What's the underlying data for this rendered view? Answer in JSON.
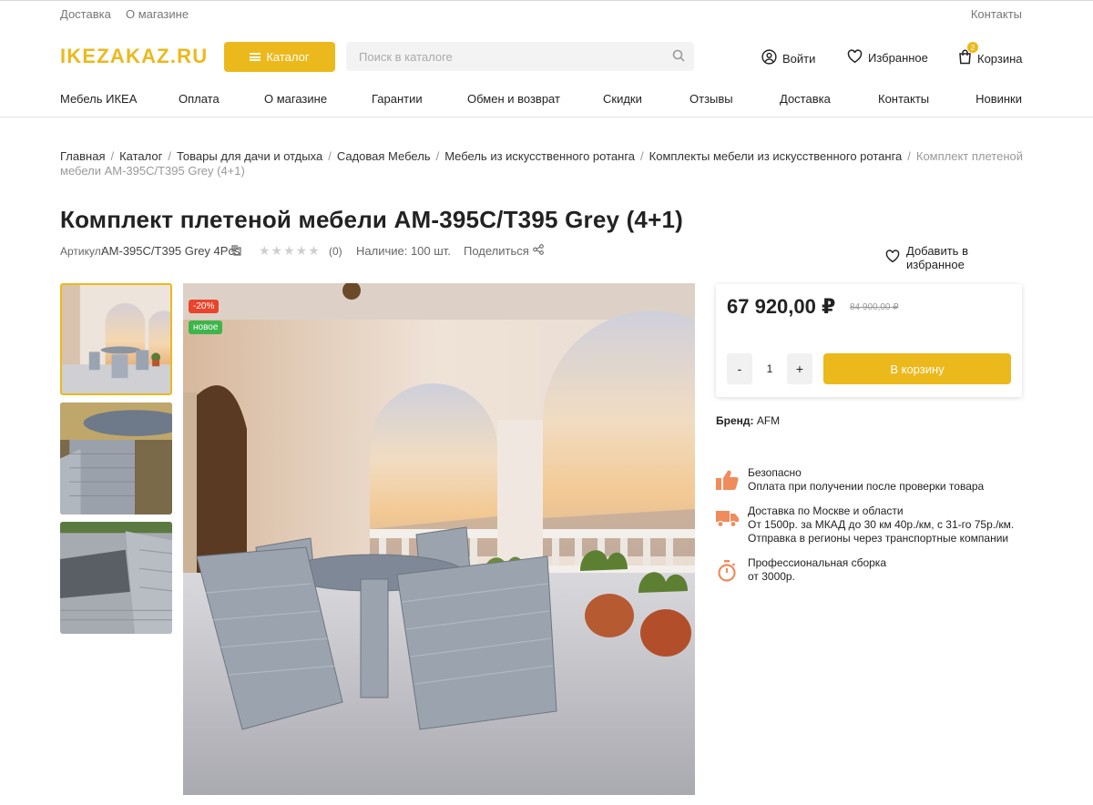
{
  "colors": {
    "accent": "#ecb91c",
    "sale_badge": "#e8452c",
    "new_badge": "#3db54a",
    "icon_orange": "#f08b5c"
  },
  "topbar": {
    "links": [
      "Доставка",
      "О магазине"
    ],
    "contacts": "Контакты"
  },
  "header": {
    "logo": "IKEZAKAZ.RU",
    "catalog_label": "Каталог",
    "search_placeholder": "Поиск в каталоге",
    "login_label": "Войти",
    "favorites_label": "Избранное",
    "cart_label": "Корзина",
    "cart_count": "2"
  },
  "nav": {
    "items": [
      "Мебель ИКЕА",
      "Оплата",
      "О магазине",
      "Гарантии",
      "Обмен и возврат",
      "Скидки",
      "Отзывы",
      "Доставка",
      "Контакты",
      "Новинки"
    ]
  },
  "breadcrumb": {
    "items": [
      "Главная",
      "Каталог",
      "Товары для дачи и отдыха",
      "Садовая Мебель",
      "Мебель из искусственного ротанга",
      "Комплекты мебели из искусственного ротанга"
    ],
    "current": "Комплект плетеной мебели AM-395C/T395 Grey (4+1)"
  },
  "product": {
    "title": "Комплект плетеной мебели AM-395C/T395 Grey (4+1)",
    "sku_label": "Артикул:",
    "sku": "AM-395C/T395 Grey 4Pcs",
    "rating": 0,
    "rating_max": 5,
    "reviews_count": "(0)",
    "availability": "Наличие: 100 шт.",
    "share_label": "Поделиться",
    "favorite_label": "Добавить в избранное",
    "badges": {
      "discount": "-20%",
      "new": "новое"
    },
    "price": "67 920,00 ₽",
    "old_price": "84 900,00 ₽",
    "qty_minus": "-",
    "quantity": "1",
    "qty_plus": "+",
    "add_to_cart": "В корзину",
    "brand_label": "Бренд:",
    "brand": "AFM"
  },
  "features": [
    {
      "icon": "thumbs-up-icon",
      "title": "Безопасно",
      "lines": [
        "Оплата при получении после проверки товара"
      ]
    },
    {
      "icon": "truck-icon",
      "title": "Доставка по Москве и области",
      "lines": [
        "От 1500р. за МКАД до 30 км 40р./км, с 31-го 75р./км.",
        "Отправка в регионы через транспортные компании"
      ]
    },
    {
      "icon": "stopwatch-icon",
      "title": "Профессиональная сборка",
      "lines": [
        "от 3000р."
      ]
    }
  ]
}
